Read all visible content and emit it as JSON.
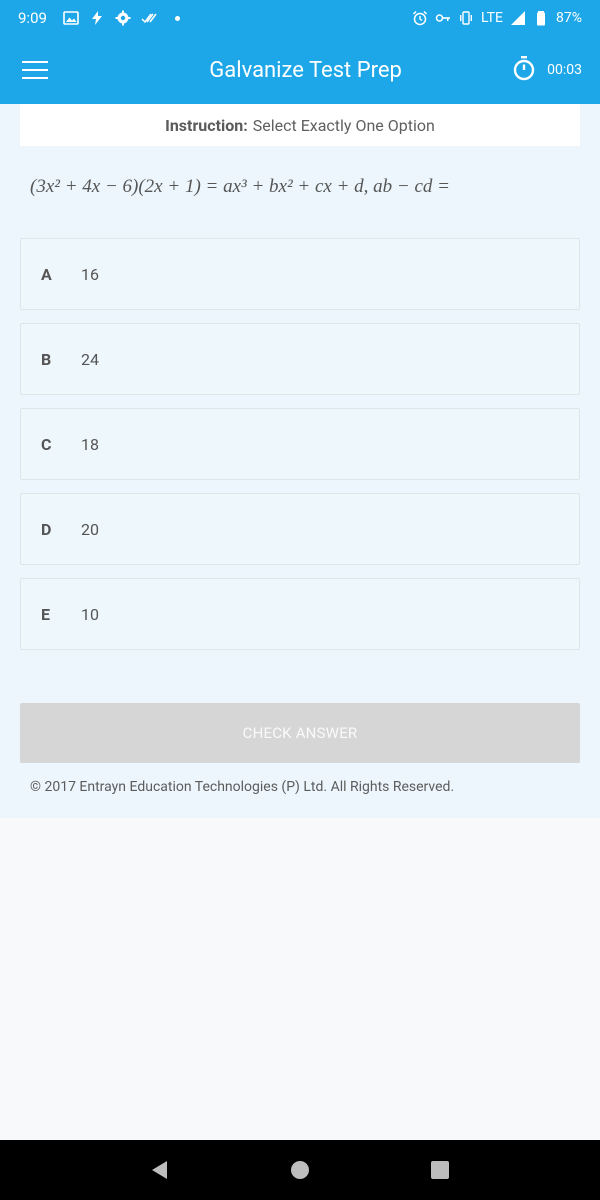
{
  "status_bar": {
    "time": "9:09",
    "network": "LTE",
    "battery": "87%"
  },
  "app_bar": {
    "title": "Galvanize Test Prep",
    "timer": "00:03"
  },
  "instruction": {
    "label": "Instruction:",
    "text": "Select Exactly One Option"
  },
  "question": {
    "text": "(3x² + 4x − 6)(2x + 1) = ax³ + bx² + cx + d, ab − cd ="
  },
  "options": [
    {
      "letter": "A",
      "value": "16"
    },
    {
      "letter": "B",
      "value": "24"
    },
    {
      "letter": "C",
      "value": "18"
    },
    {
      "letter": "D",
      "value": "20"
    },
    {
      "letter": "E",
      "value": "10"
    }
  ],
  "check_button": "CHECK ANSWER",
  "footer": "© 2017 Entrayn Education Technologies (P) Ltd. All Rights Reserved.",
  "colors": {
    "primary": "#1ea7e8",
    "content_bg": "#ecf6fc",
    "button_disabled": "#d6d6d6"
  }
}
